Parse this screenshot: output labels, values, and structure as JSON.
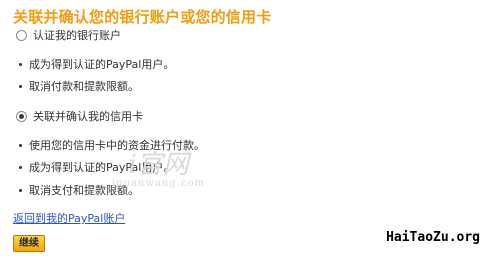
{
  "title": "关联并确认您的银行账户或您的信用卡",
  "options": [
    {
      "label": "认证我的银行账户",
      "selected": false,
      "bullets": [
        "成为得到认证的PayPal用户。",
        "取消付款和提款限额。"
      ]
    },
    {
      "label": "关联并确认我的信用卡",
      "selected": true,
      "bullets": [
        "使用您的信用卡中的资金进行付款。",
        "成为得到认证的PayPal用户。",
        "取消支付和提款限额。"
      ]
    }
  ],
  "back_link": "返回到我的PayPal账户",
  "continue_button": "继续",
  "watermark": {
    "big": "i官网",
    "small": "iguanwang.com"
  },
  "site_label": "HaiTaoZu.org",
  "colors": {
    "title": "#f39c12",
    "link": "#2b55c5",
    "button": "#f6b31c"
  }
}
